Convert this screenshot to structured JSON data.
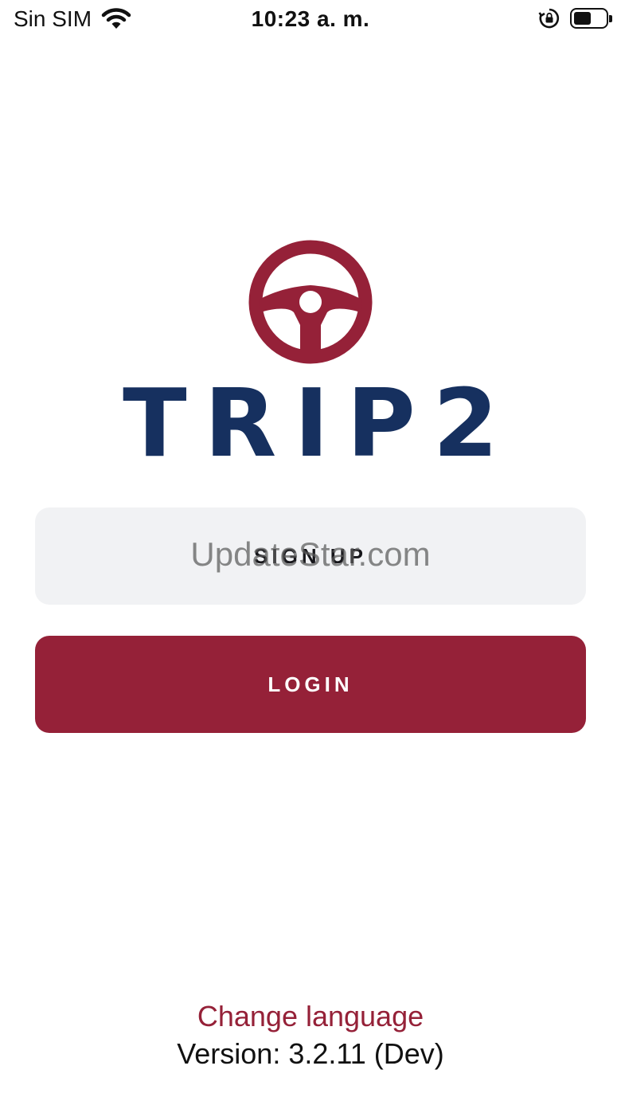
{
  "status_bar": {
    "carrier": "Sin SIM",
    "time": "10:23 a. m.",
    "battery_level": 0.55,
    "icons": [
      "wifi-icon",
      "rotation-lock-icon",
      "battery-icon"
    ]
  },
  "logo": {
    "wordmark": "TRIP2",
    "icon": "steering-wheel-icon",
    "wheel_color": "#952138",
    "wordmark_color": "#16305f"
  },
  "buttons": {
    "signup_label": "SIGN UP",
    "login_label": "LOGIN"
  },
  "watermark": "UpdateStar.com",
  "footer": {
    "change_language": "Change language",
    "version": "Version: 3.2.11 (Dev)"
  },
  "colors": {
    "accent": "#952138",
    "brand_navy": "#16305f",
    "secondary_button": "#f1f2f4"
  }
}
